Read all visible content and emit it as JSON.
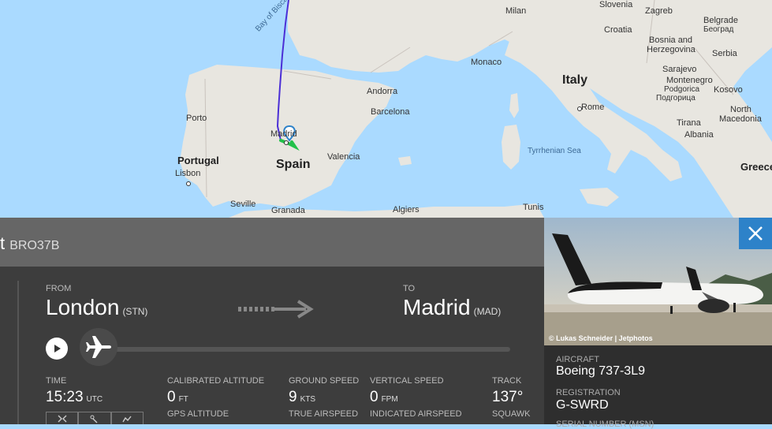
{
  "map": {
    "labels": [
      {
        "name": "label-slovenia",
        "text": "Slovenia"
      },
      {
        "name": "label-zagreb",
        "text": "Zagreb"
      },
      {
        "name": "label-belgrade",
        "text": "Belgrade"
      },
      {
        "name": "label-beograd",
        "text": "Београд"
      },
      {
        "name": "label-milan",
        "text": "Milan"
      },
      {
        "name": "label-croatia",
        "text": "Croatia"
      },
      {
        "name": "label-bosnia",
        "text": "Bosnia and"
      },
      {
        "name": "label-herzegovina",
        "text": "Herzegovina"
      },
      {
        "name": "label-serbia",
        "text": "Serbia"
      },
      {
        "name": "label-sarajevo",
        "text": "Sarajevo"
      },
      {
        "name": "label-monaco",
        "text": "Monaco"
      },
      {
        "name": "label-italy",
        "text": "Italy"
      },
      {
        "name": "label-montenegro",
        "text": "Montenegro"
      },
      {
        "name": "label-podgorica",
        "text": "Podgorica"
      },
      {
        "name": "label-podgorica-cyr",
        "text": "Подгорица"
      },
      {
        "name": "label-kosovo",
        "text": "Kosovo"
      },
      {
        "name": "label-bay-of-biscay",
        "text": "Bay of Biscay"
      },
      {
        "name": "label-andorra",
        "text": "Andorra"
      },
      {
        "name": "label-rome",
        "text": "Rome"
      },
      {
        "name": "label-north-macedonia-1",
        "text": "North"
      },
      {
        "name": "label-north-macedonia-2",
        "text": "Macedonia"
      },
      {
        "name": "label-porto",
        "text": "Porto"
      },
      {
        "name": "label-barcelona",
        "text": "Barcelona"
      },
      {
        "name": "label-tirana",
        "text": "Tirana"
      },
      {
        "name": "label-albania",
        "text": "Albania"
      },
      {
        "name": "label-madrid",
        "text": "Madrid"
      },
      {
        "name": "label-tyrrhenian-sea",
        "text": "Tyrrhenian Sea"
      },
      {
        "name": "label-portugal",
        "text": "Portugal"
      },
      {
        "name": "label-spain",
        "text": "Spain"
      },
      {
        "name": "label-valencia",
        "text": "Valencia"
      },
      {
        "name": "label-lisbon",
        "text": "Lisbon"
      },
      {
        "name": "label-greece",
        "text": "Greece"
      },
      {
        "name": "label-seville",
        "text": "Seville"
      },
      {
        "name": "label-granada",
        "text": "Granada"
      },
      {
        "name": "label-algiers",
        "text": "Algiers"
      },
      {
        "name": "label-tunis",
        "text": "Tunis"
      }
    ]
  },
  "flight": {
    "callsign": "BRO37B",
    "from_label": "FROM",
    "from_city": "London",
    "from_code": "(STN)",
    "to_label": "TO",
    "to_city": "Madrid",
    "to_code": "(MAD)"
  },
  "stats": {
    "time_label": "TIME",
    "time_value": "15:23",
    "time_unit": "UTC",
    "cal_alt_label": "CALIBRATED ALTITUDE",
    "cal_alt_value": "0",
    "cal_alt_unit": "FT",
    "gps_alt_label": "GPS ALTITUDE",
    "ground_speed_label": "GROUND SPEED",
    "ground_speed_value": "9",
    "ground_speed_unit": "KTS",
    "true_airspeed_label": "TRUE AIRSPEED",
    "vertical_speed_label": "VERTICAL SPEED",
    "vertical_speed_value": "0",
    "vertical_speed_unit": "FPM",
    "indicated_airspeed_label": "INDICATED AIRSPEED",
    "track_label": "TRACK",
    "track_value": "137°",
    "squawk_label": "SQUAWK"
  },
  "aircraft": {
    "photo_credit": "© Lukas Schneider | Jetphotos",
    "aircraft_label": "AIRCRAFT",
    "aircraft_value": "Boeing 737-3L9",
    "registration_label": "REGISTRATION",
    "registration_value": "G-SWRD",
    "serial_label": "SERIAL NUMBER (MSN)"
  },
  "colors": {
    "accent": "#2d82c9",
    "panel_bg": "#3d3d3d",
    "route_line": "#4b2fd6",
    "route_ground": "#22c14a"
  }
}
